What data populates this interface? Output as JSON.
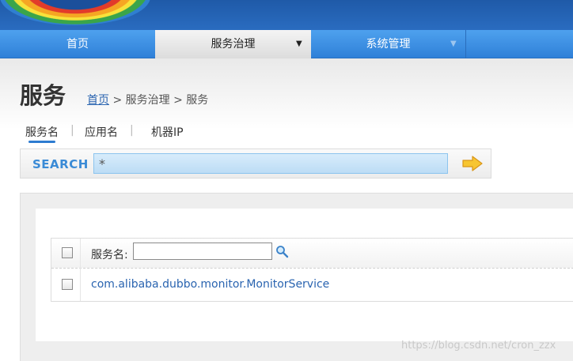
{
  "nav": {
    "items": [
      {
        "label": "首页"
      },
      {
        "label": "服务治理",
        "arrow": "▼"
      },
      {
        "label": "系统管理",
        "arrow": "▼"
      }
    ]
  },
  "header": {
    "title": "服务",
    "breadcrumb": {
      "home": "首页",
      "sep1": ">",
      "middle": "服务治理",
      "sep2": ">",
      "current": "服务"
    }
  },
  "tabs": {
    "items": [
      {
        "label": "服务名"
      },
      {
        "label": "应用名"
      },
      {
        "label": "机器IP"
      }
    ],
    "separator": "|"
  },
  "search": {
    "label": "SEARCH",
    "value": "*",
    "go_icon": "arrow-right-icon"
  },
  "table": {
    "header_label": "服务名:",
    "filter_value": "",
    "filter_icon": "magnifier-icon",
    "rows": [
      {
        "service": "com.alibaba.dubbo.monitor.MonitorService"
      }
    ]
  },
  "watermark": "https://blog.csdn.net/cron_zzx",
  "colors": {
    "accent": "#2f80d8",
    "link": "#2a64b0",
    "search_label": "#3b8bd6"
  }
}
